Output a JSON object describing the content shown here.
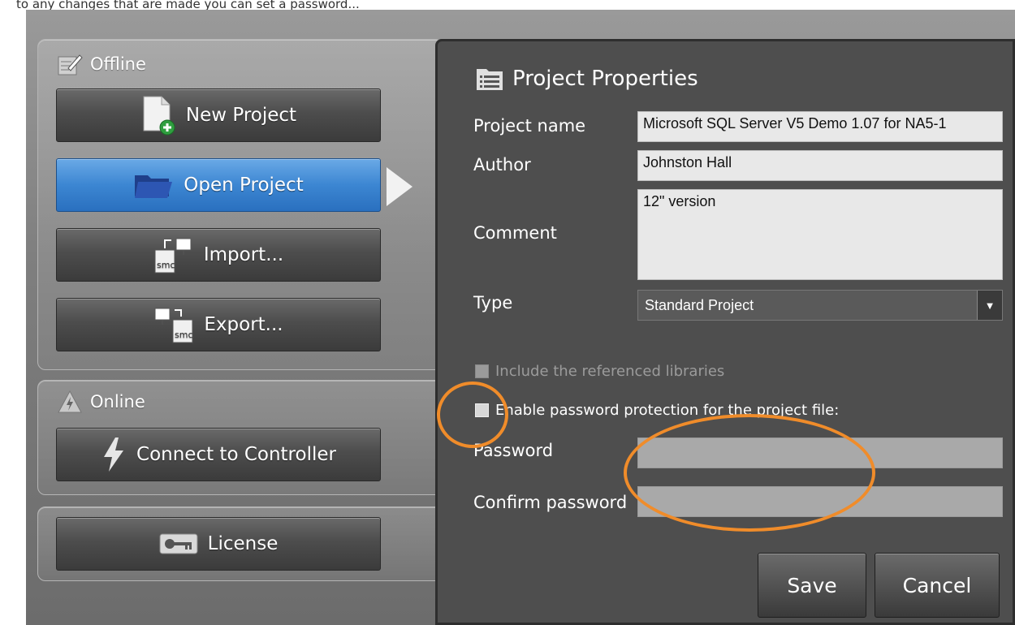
{
  "caption": "to any changes that are made you can set a password...",
  "offline": {
    "header": "Offline",
    "buttons": {
      "new": "New Project",
      "open": "Open Project",
      "import": "Import...",
      "export": "Export..."
    }
  },
  "online": {
    "header": "Online",
    "connect": "Connect to Controller"
  },
  "license": {
    "label": "License"
  },
  "dialog": {
    "title": "Project Properties",
    "labels": {
      "project_name": "Project name",
      "author": "Author",
      "comment": "Comment",
      "type": "Type",
      "password": "Password",
      "confirm_password": "Confirm password"
    },
    "values": {
      "project_name": "Microsoft SQL Server V5 Demo 1.07 for NA5-1",
      "author": "Johnston Hall",
      "comment": "12\" version",
      "type": "Standard Project",
      "password": "",
      "confirm_password": ""
    },
    "include_libraries": "Include the referenced libraries",
    "enable_password": "Enable password protection for the project file:",
    "save": "Save",
    "cancel": "Cancel"
  },
  "colors": {
    "highlight": "#f08c2a",
    "active": "#3c86d2"
  }
}
